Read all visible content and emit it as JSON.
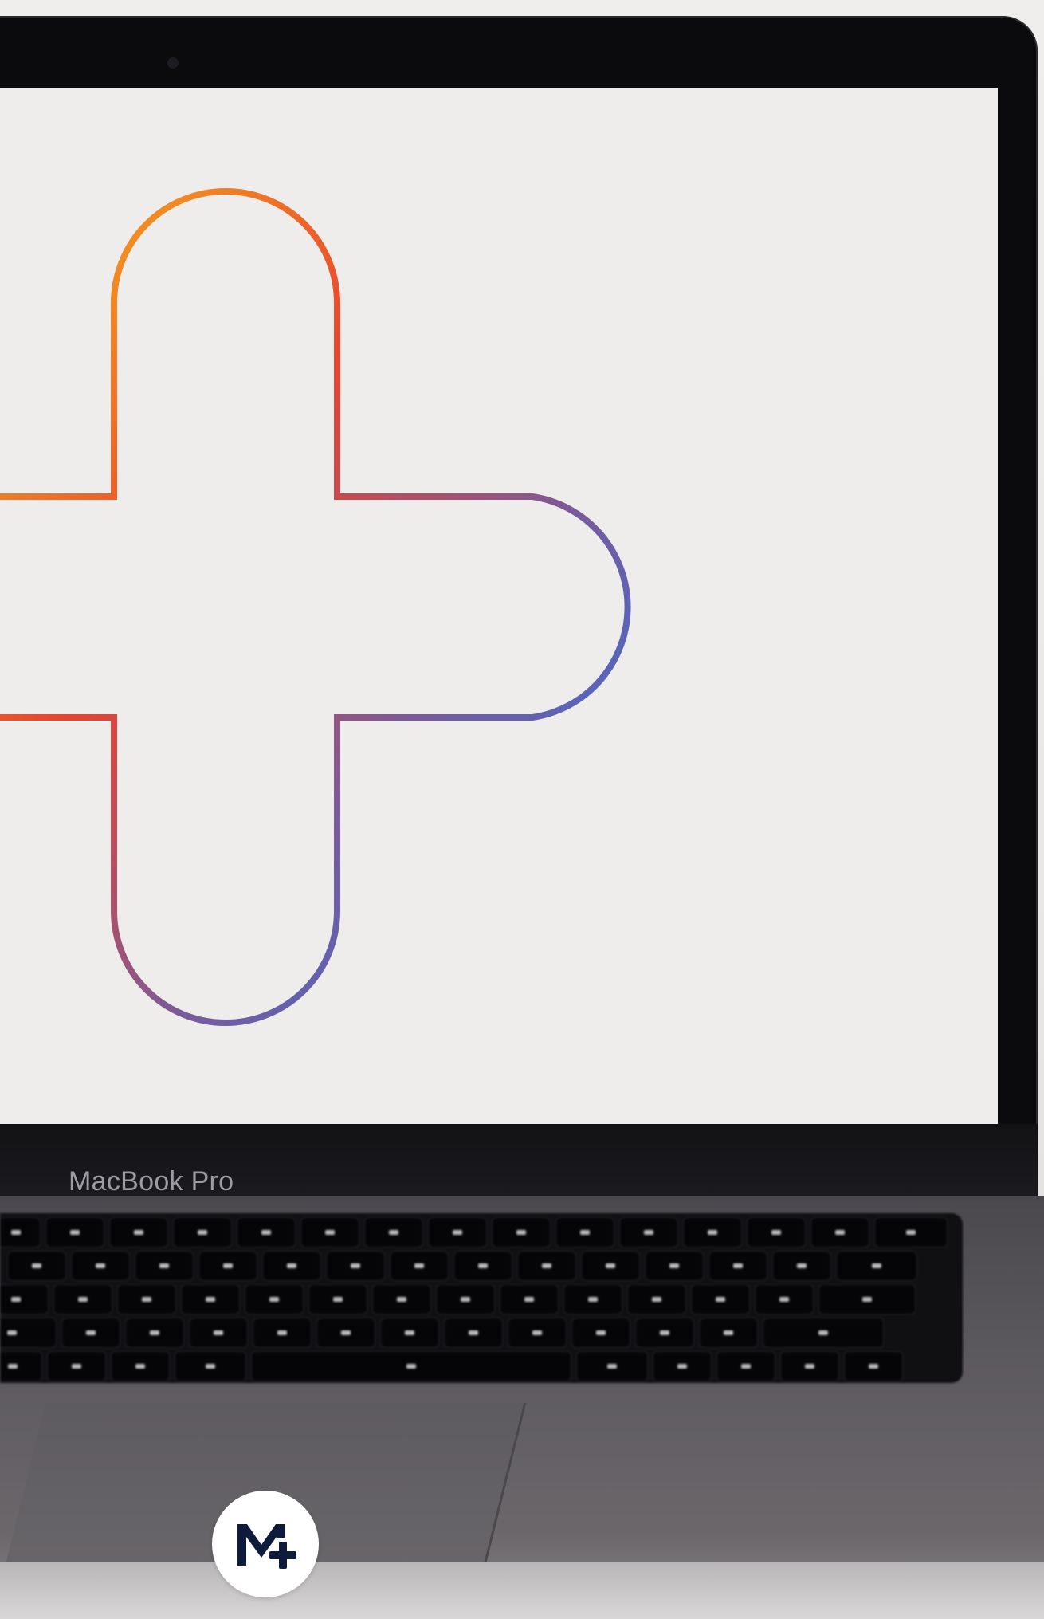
{
  "device": {
    "brand_label": "MacBook Pro"
  },
  "screen": {
    "background_color": "#efedec",
    "graphic": "plus-outline-icon",
    "gradient_colors": [
      "#f6b91c",
      "#e8432f",
      "#7a5a9a",
      "#1f78ee"
    ]
  },
  "logo": {
    "icon": "m-plus-logo-icon",
    "badge_color": "#ffffff",
    "mark_color": "#0f1b3a"
  }
}
